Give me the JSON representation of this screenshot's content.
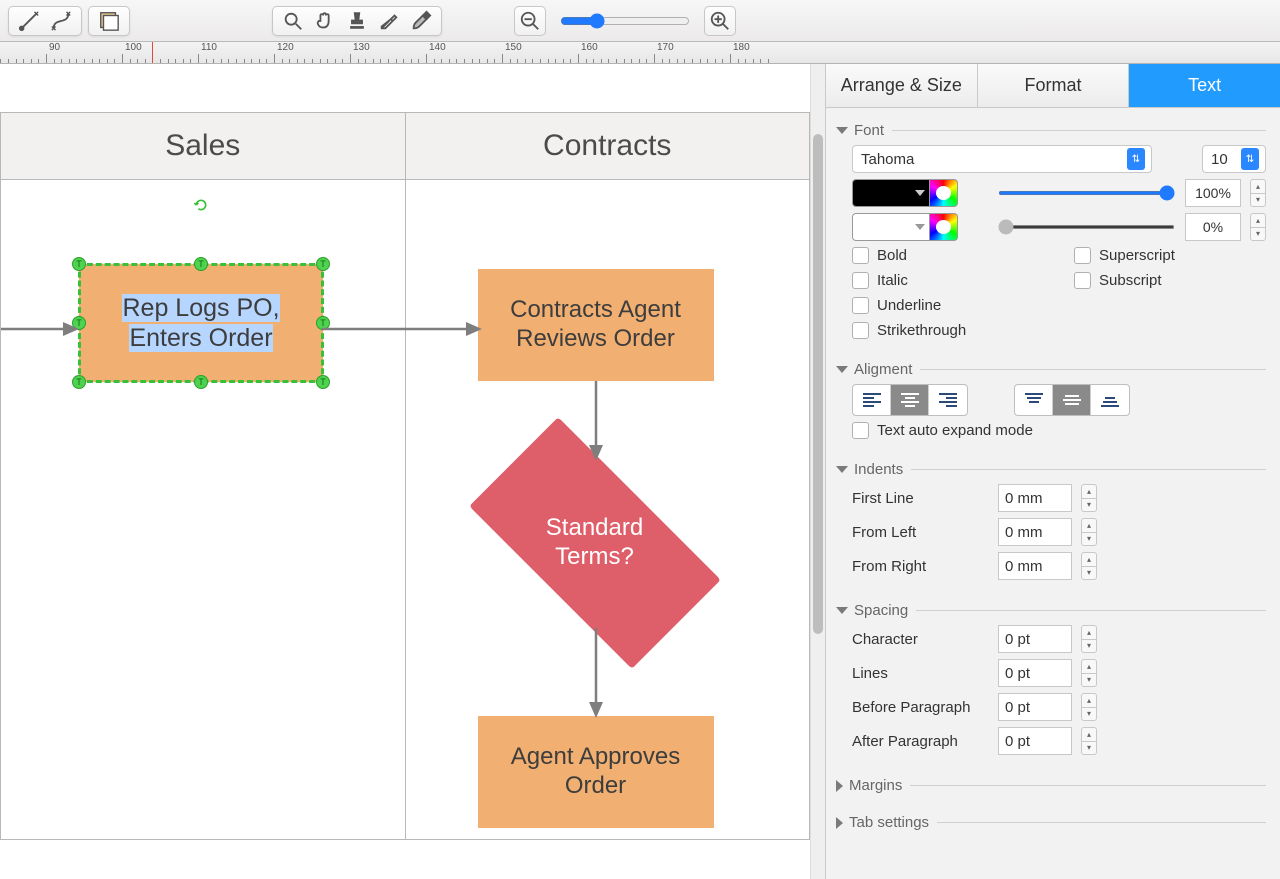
{
  "toolbar": {
    "icons": [
      "connector-direct",
      "connector-curve",
      "layers",
      "search",
      "hand",
      "stamp",
      "eyedropper",
      "paintbrush",
      "zoom-out",
      "zoom-in"
    ]
  },
  "ruler": {
    "start": 80,
    "step": 10,
    "major_every": 1,
    "marker_at": 104,
    "end": 185
  },
  "canvas": {
    "lane_headers": [
      "Sales",
      "Contracts"
    ],
    "nodes": {
      "rep": "Rep Logs PO,\nEnters Order",
      "review": "Contracts Agent\nReviews Order",
      "terms": "Standard\nTerms?",
      "approve": "Agent Approves\nOrder"
    }
  },
  "panel": {
    "tabs": [
      "Arrange & Size",
      "Format",
      "Text"
    ],
    "active_tab": 2,
    "font": {
      "section": "Font",
      "family": "Tahoma",
      "size": "10",
      "fg_opacity": "100%",
      "bg_opacity": "0%",
      "checks": [
        "Bold",
        "Italic",
        "Underline",
        "Strikethrough",
        "Superscript",
        "Subscript"
      ]
    },
    "alignment": {
      "section": "Aligment",
      "expand_label": "Text auto expand mode"
    },
    "indents": {
      "section": "Indents",
      "rows": [
        {
          "label": "First Line",
          "value": "0 mm"
        },
        {
          "label": "From Left",
          "value": "0 mm"
        },
        {
          "label": "From Right",
          "value": "0 mm"
        }
      ]
    },
    "spacing": {
      "section": "Spacing",
      "rows": [
        {
          "label": "Character",
          "value": "0 pt"
        },
        {
          "label": "Lines",
          "value": "0 pt"
        },
        {
          "label": "Before Paragraph",
          "value": "0 pt"
        },
        {
          "label": "After Paragraph",
          "value": "0 pt"
        }
      ]
    },
    "margins": {
      "section": "Margins"
    },
    "tabset": {
      "section": "Tab settings"
    }
  }
}
